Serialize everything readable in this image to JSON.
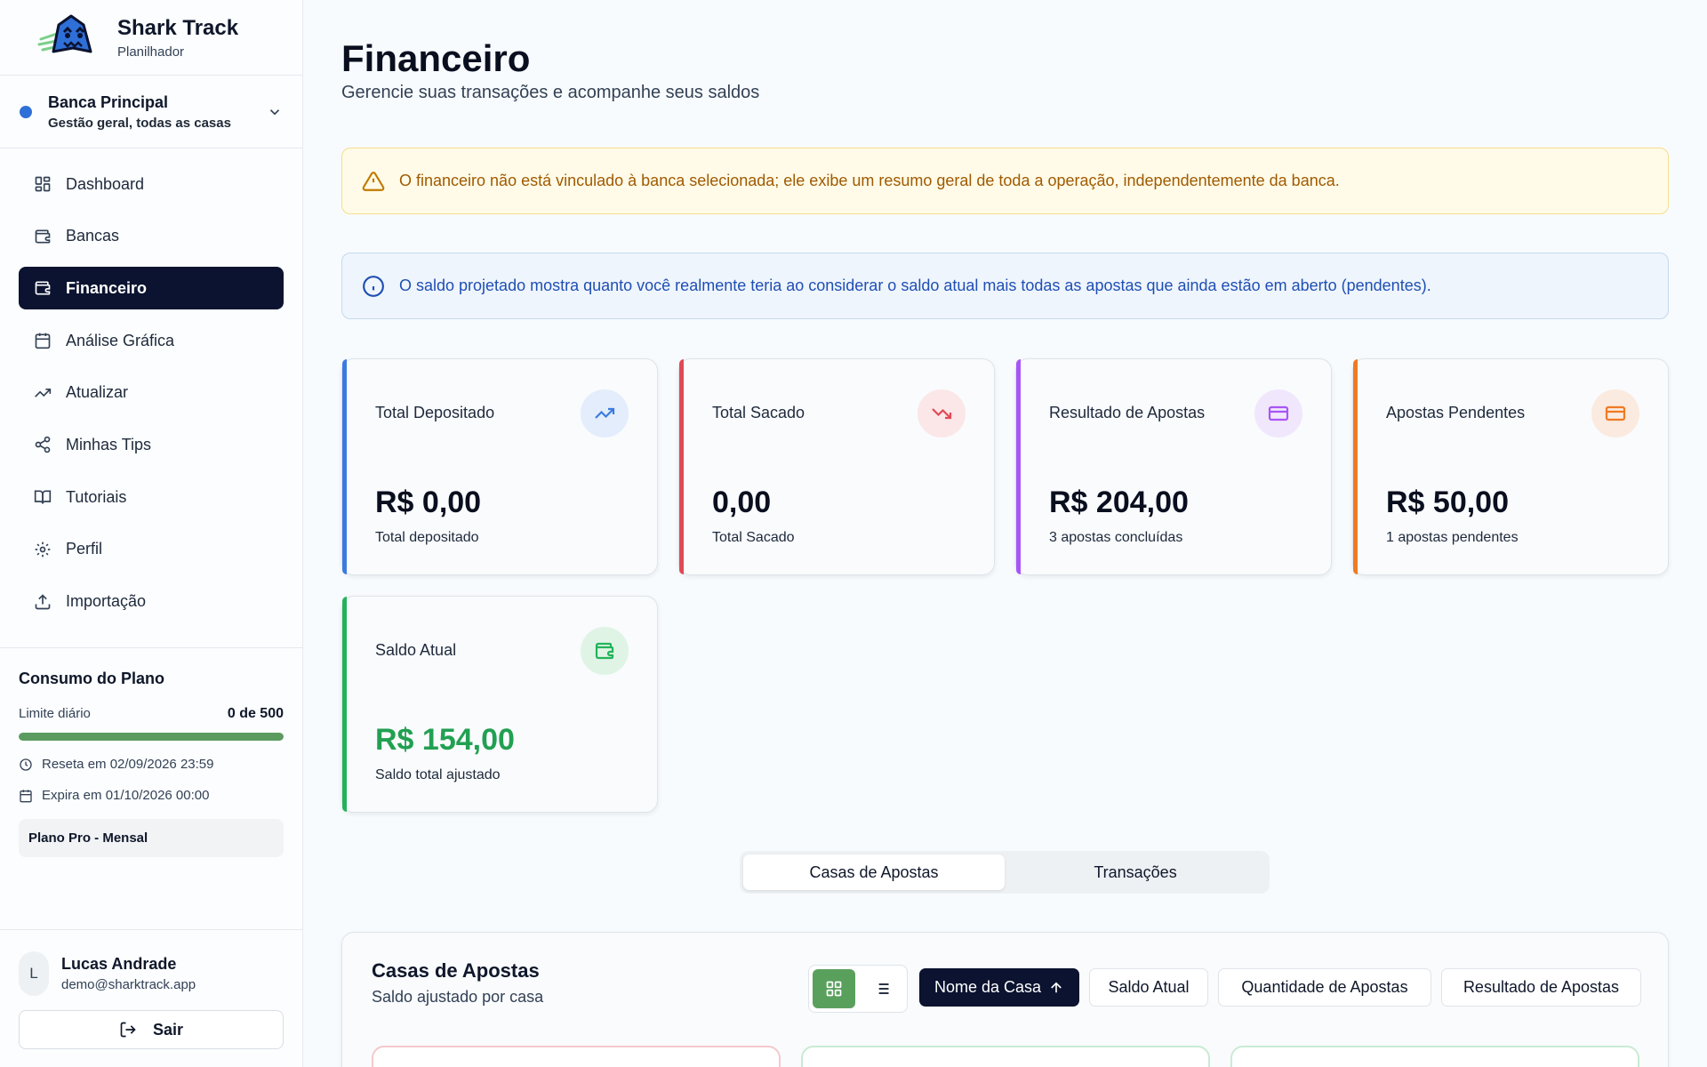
{
  "brand": {
    "name": "Shark Track",
    "subtitle": "Planilhador"
  },
  "bank": {
    "name": "Banca Principal",
    "description": "Gestão geral, todas as casas",
    "dot_color": "#2f6fd8"
  },
  "nav": {
    "items": [
      {
        "label": "Dashboard",
        "icon": "dashboard-icon"
      },
      {
        "label": "Bancas",
        "icon": "wallet-icon"
      },
      {
        "label": "Financeiro",
        "icon": "wallet-icon",
        "active": true
      },
      {
        "label": "Análise Gráfica",
        "icon": "calendar-icon"
      },
      {
        "label": "Atualizar",
        "icon": "trending-up-icon"
      },
      {
        "label": "Minhas Tips",
        "icon": "share-icon"
      },
      {
        "label": "Tutoriais",
        "icon": "book-icon"
      },
      {
        "label": "Perfil",
        "icon": "gear-icon"
      },
      {
        "label": "Importação",
        "icon": "upload-icon"
      }
    ]
  },
  "plan": {
    "title": "Consumo do Plano",
    "limit_label": "Limite diário",
    "limit_value": "0 de 500",
    "usage_fraction": 0.0,
    "reset": "Reseta em 02/09/2026 23:59",
    "expires": "Expira em 01/10/2026 00:00",
    "badge": "Plano Pro - Mensal"
  },
  "user": {
    "initial": "L",
    "name": "Lucas Andrade",
    "email": "demo@sharktrack.app",
    "logout_label": "Sair"
  },
  "page": {
    "title": "Financeiro",
    "subtitle": "Gerencie suas transações e acompanhe seus saldos"
  },
  "alerts": {
    "warning": "O financeiro não está vinculado à banca selecionada; ele exibe um resumo geral de toda a operação, independentemente da banca.",
    "info": "O saldo projetado mostra quanto você realmente teria ao considerar o saldo atual mais todas as apostas que ainda estão em aberto (pendentes)."
  },
  "cards": [
    {
      "label": "Total Depositado",
      "value": "R$ 0,00",
      "note": "Total depositado",
      "accent": "#3b7be0",
      "icon": "trending-up-icon"
    },
    {
      "label": "Total Sacado",
      "value": "0,00",
      "note": "Total Sacado",
      "accent": "#e04a55",
      "icon": "trending-down-icon"
    },
    {
      "label": "Resultado de Apostas",
      "value": "R$ 204,00",
      "note": "3 apostas concluídas",
      "accent": "#a855f7",
      "icon": "credit-card-icon"
    },
    {
      "label": "Apostas Pendentes",
      "value": "R$ 50,00",
      "note": "1 apostas pendentes",
      "accent": "#f07a24",
      "icon": "credit-card-icon"
    },
    {
      "label": "Saldo Atual",
      "value": "R$ 154,00",
      "note": "Saldo total ajustado",
      "accent": "#22b35a",
      "icon": "wallet-icon"
    }
  ],
  "tabs": [
    {
      "label": "Casas de Apostas",
      "active": true
    },
    {
      "label": "Transações"
    }
  ],
  "panel": {
    "title": "Casas de Apostas",
    "subtitle": "Saldo ajustado por casa",
    "sort_options": [
      {
        "label": "Nome da Casa",
        "active": true
      },
      {
        "label": "Saldo Atual"
      },
      {
        "label": "Quantidade de Apostas"
      },
      {
        "label": "Resultado de Apostas"
      }
    ]
  }
}
